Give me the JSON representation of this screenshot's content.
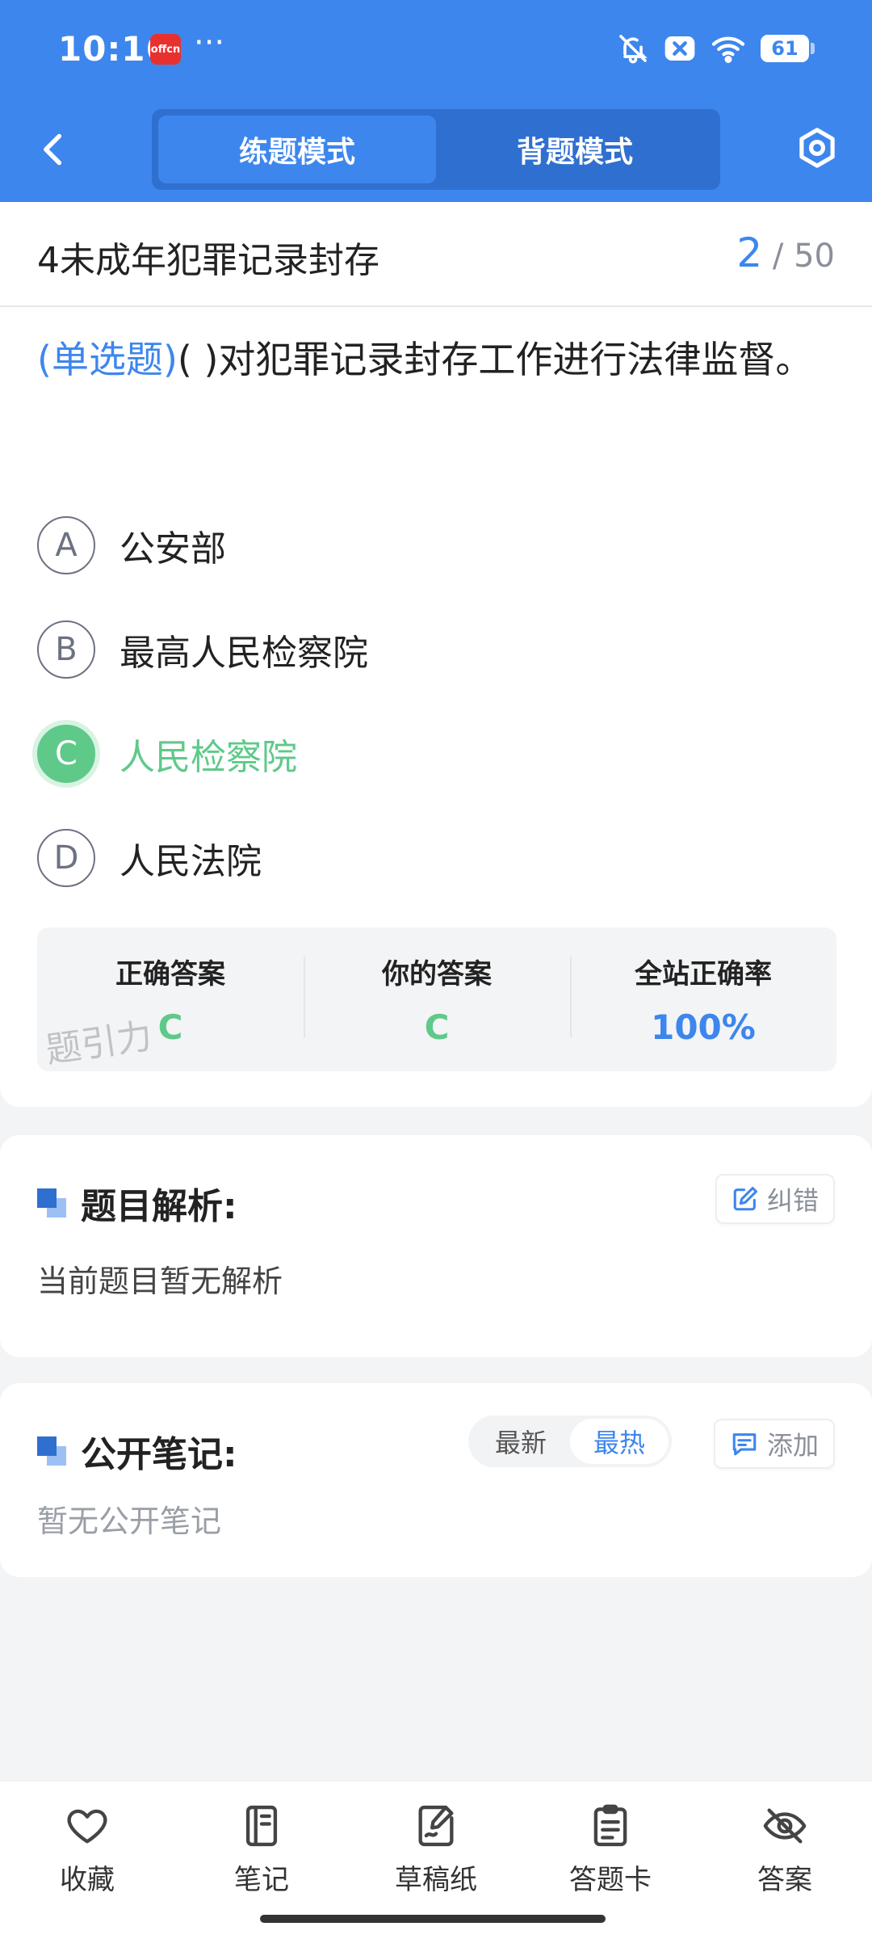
{
  "status_bar": {
    "time": "10:16",
    "app_badge": "offcn",
    "more": "···",
    "battery": "61"
  },
  "nav": {
    "tabs": [
      {
        "label": "练题模式",
        "active": true
      },
      {
        "label": "背题模式",
        "active": false
      }
    ]
  },
  "topic": {
    "title": "4未成年犯罪记录封存",
    "current": "2",
    "separator": "/",
    "total": "50"
  },
  "question": {
    "type": "(单选题)",
    "text": "(        )对犯罪记录封存工作进行法律监督。",
    "options": [
      {
        "letter": "A",
        "text": "公安部"
      },
      {
        "letter": "B",
        "text": "最高人民检察院"
      },
      {
        "letter": "C",
        "text": "人民检察院"
      },
      {
        "letter": "D",
        "text": "人民法院"
      }
    ]
  },
  "answer": {
    "correct_label": "正确答案",
    "correct_value": "C",
    "yours_label": "你的答案",
    "yours_value": "C",
    "rate_label": "全站正确率",
    "rate_value": "100%",
    "watermark": "题引力"
  },
  "analysis": {
    "title": "题目解析:",
    "button": "纠错",
    "body": "当前题目暂无解析"
  },
  "notes": {
    "title": "公开笔记:",
    "sort": [
      "最新",
      "最热"
    ],
    "button": "添加",
    "body": "暂无公开笔记"
  },
  "bottom_bar": {
    "items": [
      {
        "label": "收藏",
        "icon": "heart-icon"
      },
      {
        "label": "笔记",
        "icon": "notebook-icon"
      },
      {
        "label": "草稿纸",
        "icon": "draft-icon"
      },
      {
        "label": "答题卡",
        "icon": "answer-card-icon"
      },
      {
        "label": "答案",
        "icon": "eye-off-icon"
      }
    ]
  },
  "colors": {
    "primary": "#3d86ed",
    "correct": "#5fc98a"
  }
}
